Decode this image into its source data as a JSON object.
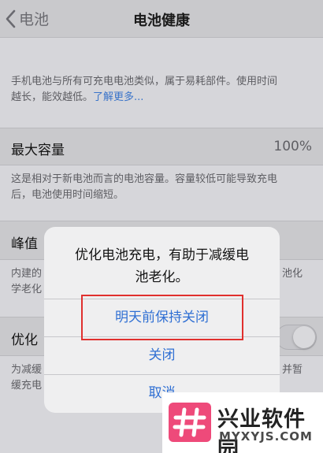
{
  "nav": {
    "back_label": "电池",
    "title": "电池健康"
  },
  "intro": {
    "text_line1": "手机电池与所有可充电电池类似，属于易耗部件。使用时间",
    "text_line2": "越长，能效越低。",
    "link": "了解更多..."
  },
  "max_capacity": {
    "label": "最大容量",
    "value": "100%"
  },
  "capacity_note": {
    "line1": "这是相对于新电池而言的电池容量。容量较低可能导致充电",
    "line2": "后，电池使用时间缩短。"
  },
  "peak": {
    "label_partial": "峰值",
    "note_left1": "内建的",
    "note_left2": "学老化",
    "note_right": "池化"
  },
  "optimized": {
    "label_partial": "优化",
    "note_left1": "为减缓",
    "note_left2": "缓充电",
    "note_right": "并暂"
  },
  "alert": {
    "message_line1": "优化电池充电，有助于减缓电",
    "message_line2": "池老化。",
    "btn_until_tomorrow": "明天前保持关闭",
    "btn_off": "关闭",
    "btn_cancel": "取消"
  },
  "watermark": {
    "title": "兴业软件园",
    "subtitle": "MYXYJS.COM"
  },
  "colors": {
    "link": "#3a74c9",
    "alert_button": "#2f6fd3",
    "highlight": "#e0302e",
    "watermark_logo": "#ee4a7a"
  }
}
